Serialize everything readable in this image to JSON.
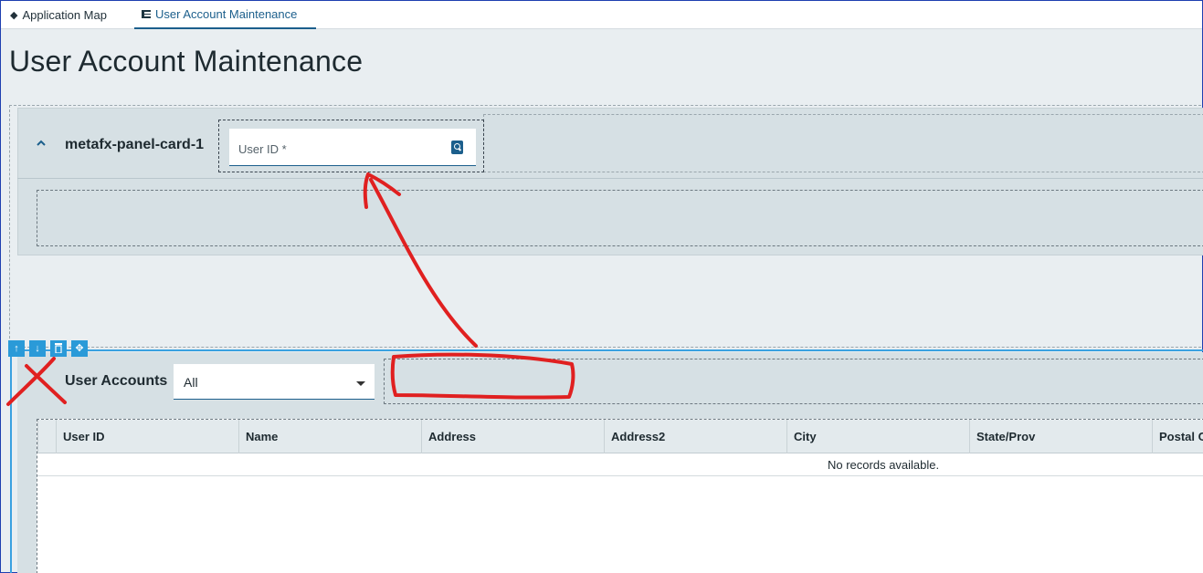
{
  "tabs": [
    {
      "label": "Application Map",
      "icon": "layers-icon",
      "active": false
    },
    {
      "label": "User Account Maintenance",
      "icon": "grid-icon",
      "active": true
    }
  ],
  "page": {
    "title": "User Account Maintenance"
  },
  "panel_card": {
    "title": "metafx-panel-card-1",
    "user_id_field": {
      "label": "User ID *",
      "value": ""
    }
  },
  "toolbar": {
    "buttons": [
      {
        "name": "move-up",
        "glyph": "↑"
      },
      {
        "name": "move-down",
        "glyph": "↓"
      },
      {
        "name": "delete",
        "glyph": "🗑"
      },
      {
        "name": "drag",
        "glyph": "✥"
      }
    ]
  },
  "user_accounts": {
    "title": "User Accounts",
    "filter": {
      "selected": "All"
    },
    "columns": [
      "User ID",
      "Name",
      "Address",
      "Address2",
      "City",
      "State/Prov",
      "Postal Code"
    ],
    "empty_message": "No records available."
  },
  "colors": {
    "accent": "#1c5f8c",
    "panel_bg": "#d6e0e4",
    "selection": "#2a9ad8",
    "annotation": "#e02020"
  }
}
